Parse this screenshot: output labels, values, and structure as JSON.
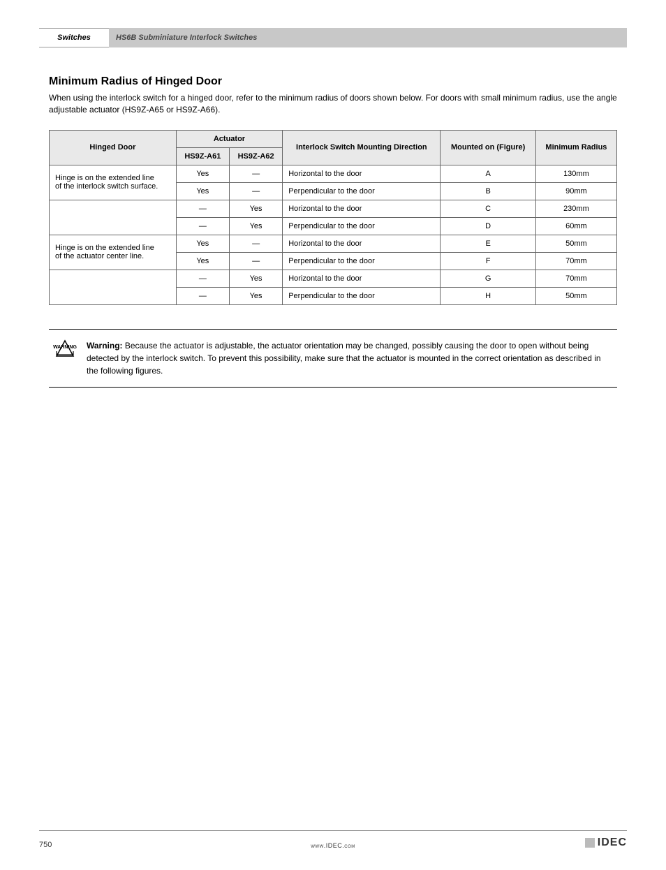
{
  "header": {
    "tab": "Switches",
    "strip": "HS6B Subminiature Interlock Switches"
  },
  "section1": {
    "title": "Minimum Radius of Hinged Door",
    "body": "When using the interlock switch for a hinged door, refer to the minimum radius of doors shown below. For doors with small minimum radius, use the angle adjustable actuator (HS9Z-A65 or HS9Z-A66)."
  },
  "table": {
    "headers": {
      "door": "Hinged Door",
      "actuator": "Actuator",
      "actuatorSubA": "HS9Z-A61",
      "actuatorSubB": "HS9Z-A62",
      "mounting": "Interlock Switch Mounting Direction",
      "mounted": "Mounted on (Figure)",
      "radius": "Minimum Radius"
    },
    "rows": [
      {
        "door": "Hinge is on the extended line",
        "a": "Yes",
        "b": "—",
        "mounting": "Horizontal to the door",
        "mounted": "A",
        "radius": "130mm"
      },
      {
        "door": "of the interlock switch surface.",
        "a": "Yes",
        "b": "—",
        "mounting": "Perpendicular to the door",
        "mounted": "B",
        "radius": "90mm"
      },
      {
        "door": "",
        "a": "—",
        "b": "Yes",
        "mounting": "Horizontal to the door",
        "mounted": "C",
        "radius": "230mm"
      },
      {
        "door": "",
        "a": "—",
        "b": "Yes",
        "mounting": "Perpendicular to the door",
        "mounted": "D",
        "radius": "60mm"
      },
      {
        "door": "Hinge is on the extended line",
        "a": "Yes",
        "b": "—",
        "mounting": "Horizontal to the door",
        "mounted": "E",
        "radius": "50mm"
      },
      {
        "door": "of the actuator center line.",
        "a": "Yes",
        "b": "—",
        "mounting": "Perpendicular to the door",
        "mounted": "F",
        "radius": "70mm"
      },
      {
        "door": "",
        "a": "—",
        "b": "Yes",
        "mounting": "Horizontal to the door",
        "mounted": "G",
        "radius": "70mm"
      },
      {
        "door": "",
        "a": "—",
        "b": "Yes",
        "mounting": "Perpendicular to the door",
        "mounted": "H",
        "radius": "50mm"
      }
    ]
  },
  "warning": {
    "label": "Warning:",
    "text": " Because the actuator is adjustable, the actuator orientation may be changed, possibly causing the door to open without being detected by the interlock switch. To prevent this possibility, make sure that the actuator is mounted in the correct orientation as described in the following figures."
  },
  "footer": {
    "page": "750",
    "center": "www.IDEC.com",
    "logo": "IDEC"
  }
}
